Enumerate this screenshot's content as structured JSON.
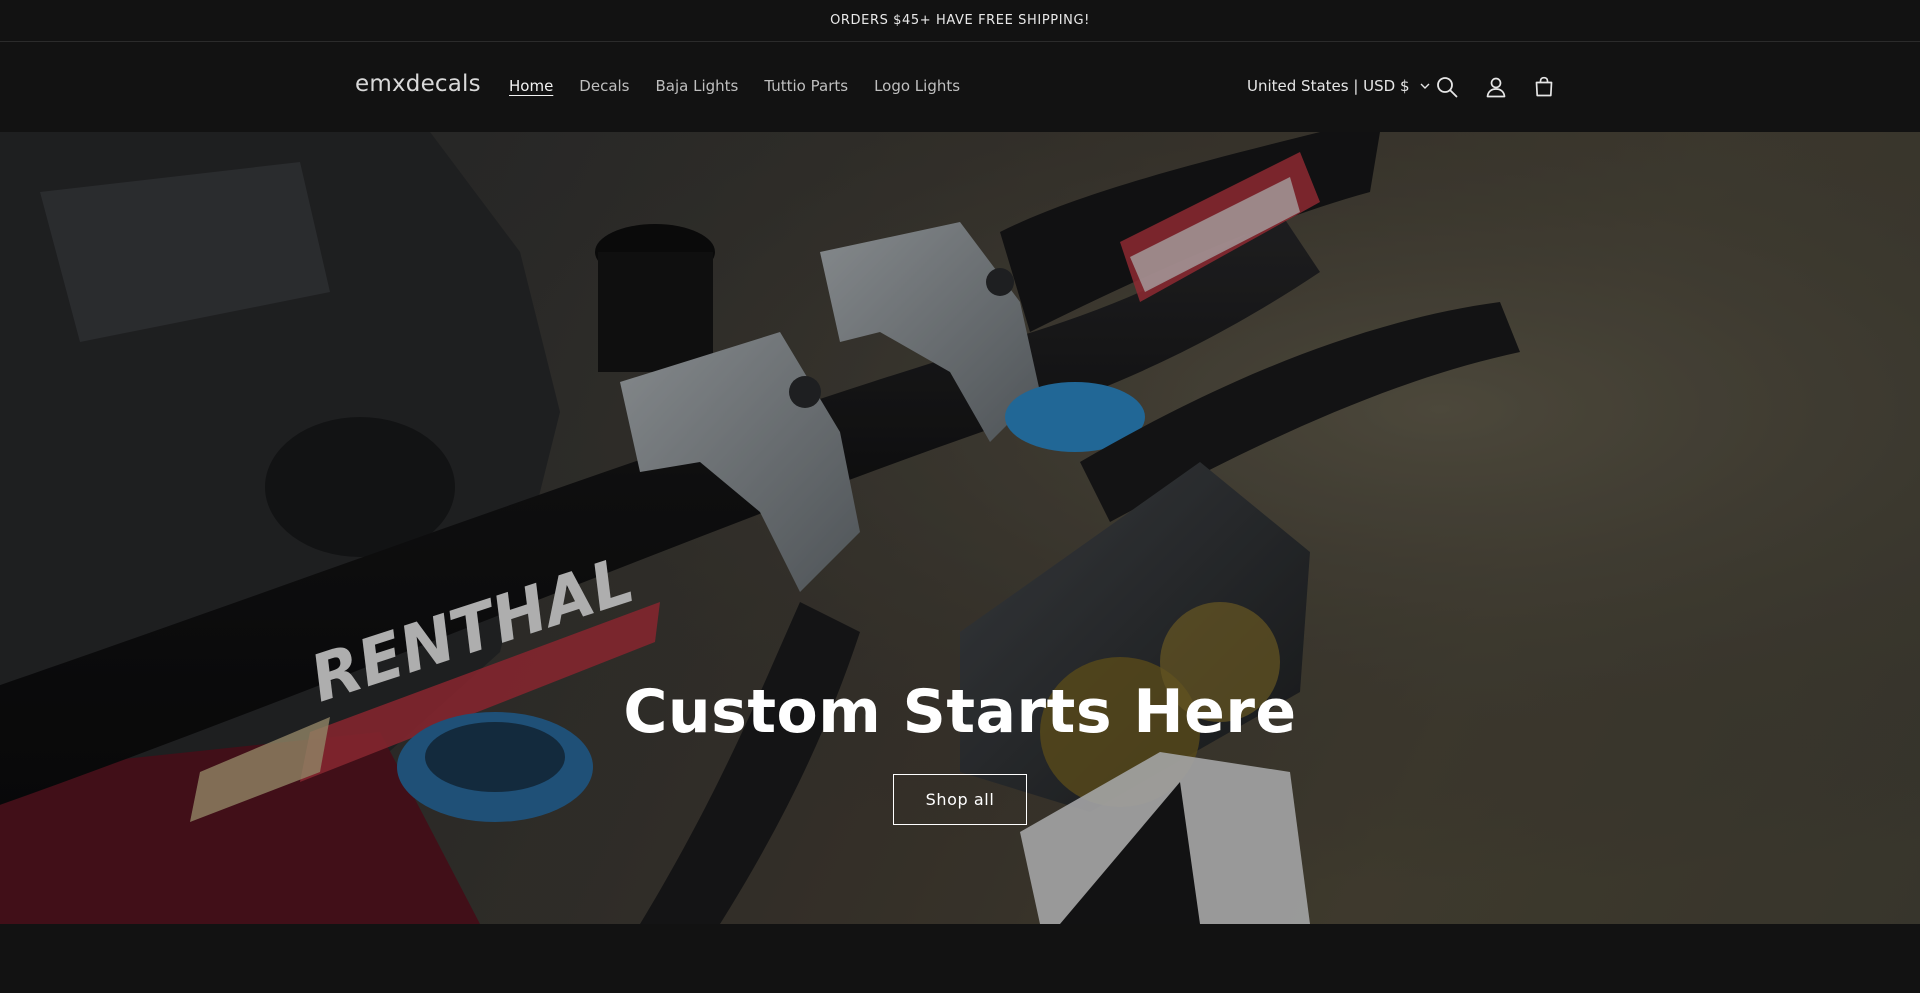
{
  "announcement": {
    "text": "ORDERS $45+ HAVE FREE SHIPPING!"
  },
  "header": {
    "logo": "emxdecals",
    "nav": [
      {
        "label": "Home",
        "active": true
      },
      {
        "label": "Decals"
      },
      {
        "label": "Baja Lights"
      },
      {
        "label": "Tuttio Parts"
      },
      {
        "label": "Logo Lights"
      }
    ],
    "country_selector": "United States | USD $",
    "icons": [
      "search-icon",
      "account-icon",
      "cart-icon",
      "chevron-down-icon"
    ]
  },
  "hero": {
    "title": "Custom Starts Here",
    "button_label": "Shop all",
    "image_brand_text": "RENTHAL"
  },
  "colors": {
    "background": "#121212",
    "text": "#ffffff",
    "nav_text": "#bfbfbf"
  }
}
